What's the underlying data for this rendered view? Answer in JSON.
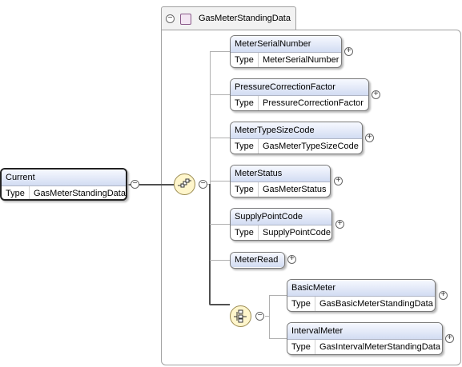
{
  "group": {
    "name": "GasMeterStandingData"
  },
  "root": {
    "name": "Current",
    "type_key": "Type",
    "type_value": "GasMeterStandingData"
  },
  "elements": [
    {
      "name": "MeterSerialNumber",
      "type_key": "Type",
      "type_value": "MeterSerialNumber"
    },
    {
      "name": "PressureCorrectionFactor",
      "type_key": "Type",
      "type_value": "PressureCorrectionFactor"
    },
    {
      "name": "MeterTypeSizeCode",
      "type_key": "Type",
      "type_value": "GasMeterTypeSizeCode"
    },
    {
      "name": "MeterStatus",
      "type_key": "Type",
      "type_value": "GasMeterStatus"
    },
    {
      "name": "SupplyPointCode",
      "type_key": "Type",
      "type_value": "SupplyPointCode"
    },
    {
      "name": "MeterRead"
    }
  ],
  "choice_elements": [
    {
      "name": "BasicMeter",
      "type_key": "Type",
      "type_value": "GasBasicMeterStandingData"
    },
    {
      "name": "IntervalMeter",
      "type_key": "Type",
      "type_value": "GasIntervalMeterStandingData"
    }
  ],
  "icons": {
    "sequence": "sequence-compositor-icon",
    "choice": "choice-compositor-icon",
    "expand": "plus-icon",
    "collapse": "minus-icon",
    "complex_type": "complex-type-icon"
  }
}
